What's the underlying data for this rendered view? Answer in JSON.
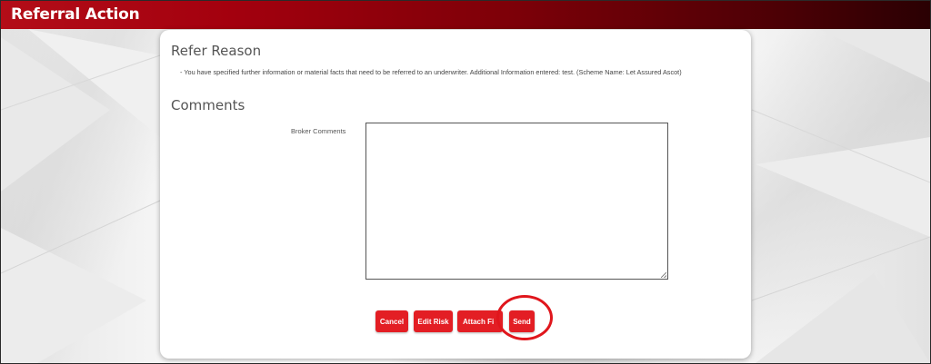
{
  "header": {
    "title": "Referral Action"
  },
  "refer_reason": {
    "title": "Refer Reason",
    "text": "- You have specified further information or material facts that need to be referred to an underwriter. Additional Information entered: test. (Scheme Name: Let Assured Ascot)"
  },
  "comments": {
    "title": "Comments",
    "broker_label": "Broker Comments",
    "broker_value": ""
  },
  "buttons": {
    "cancel": "Cancel",
    "edit_risk": "Edit Risk",
    "attach_file": "Attach Fi",
    "send": "Send"
  },
  "colors": {
    "header_start": "#b30d18",
    "header_end": "#2a0003",
    "button": "#e31e24",
    "highlight": "#e0161c"
  }
}
